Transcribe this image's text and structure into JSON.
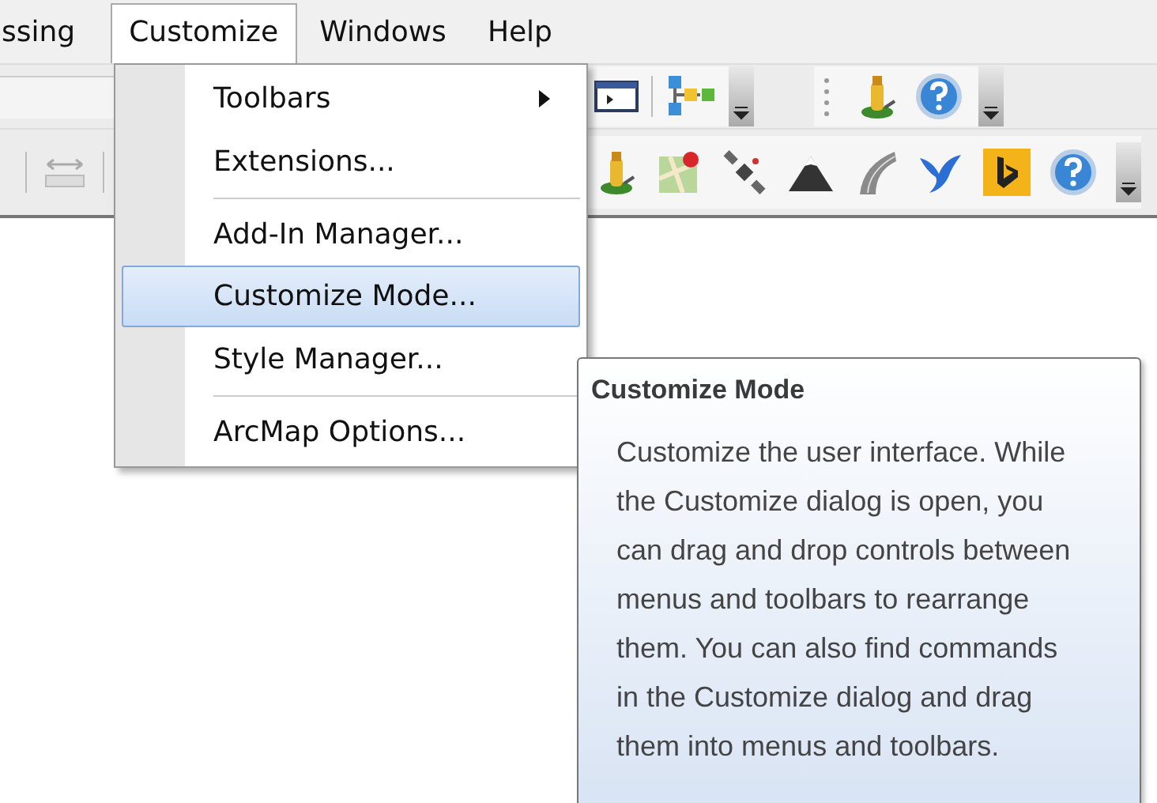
{
  "menubar": [
    {
      "label": "ssing",
      "selected": false
    },
    {
      "label": "Customize",
      "selected": true
    },
    {
      "label": "Windows",
      "selected": false
    },
    {
      "label": "Help",
      "selected": false
    }
  ],
  "menu": {
    "items": [
      {
        "kind": "item",
        "label": "Toolbars",
        "submenu": true,
        "selected": false
      },
      {
        "kind": "item",
        "label": "Extensions...",
        "submenu": false,
        "selected": false
      },
      {
        "kind": "separator"
      },
      {
        "kind": "item",
        "label": "Add-In Manager...",
        "submenu": false,
        "selected": false
      },
      {
        "kind": "item",
        "label": "Customize Mode...",
        "submenu": false,
        "selected": true
      },
      {
        "kind": "item",
        "label": "Style Manager...",
        "submenu": false,
        "selected": false
      },
      {
        "kind": "separator"
      },
      {
        "kind": "item",
        "label": "ArcMap Options...",
        "submenu": false,
        "selected": false
      }
    ]
  },
  "tooltip": {
    "title": "Customize Mode",
    "body": "Customize the user interface. While the Customize dialog is open, you can drag and drop controls between menus and toolbars to rearrange them. You can also find commands in the Customize dialog and drag them into menus and toolbars."
  }
}
